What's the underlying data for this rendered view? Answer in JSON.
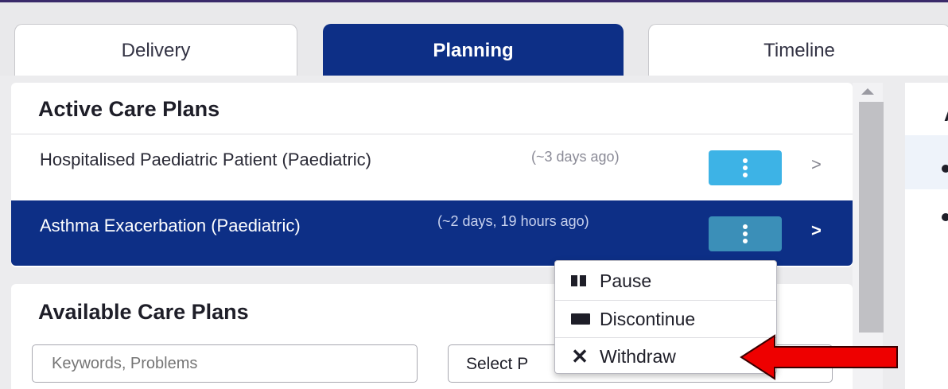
{
  "tabs": [
    {
      "label": "Delivery",
      "active": false
    },
    {
      "label": "Planning",
      "active": true
    },
    {
      "label": "Timeline",
      "active": false
    }
  ],
  "active_care_plans": {
    "title": "Active Care Plans",
    "items": [
      {
        "name": "Hospitalised Paediatric Patient (Paediatric)",
        "time": "(~3 days ago)",
        "selected": false
      },
      {
        "name": "Asthma Exacerbation (Paediatric)",
        "time": "(~2 days, 19 hours ago)",
        "selected": true
      }
    ],
    "chevron": ">"
  },
  "available_care_plans": {
    "title": "Available Care Plans",
    "search_placeholder": "Keywords, Problems",
    "select_value": "Select P"
  },
  "context_menu": {
    "items": [
      {
        "label": "Pause",
        "icon": "pause-icon"
      },
      {
        "label": "Discontinue",
        "icon": "stop-icon"
      },
      {
        "label": "Withdraw",
        "icon": "close-icon"
      }
    ]
  },
  "right_panel": {
    "title": "A"
  },
  "colors": {
    "primary_navy": "#0d2f86",
    "kebab_light": "#3db3e6",
    "kebab_selected": "#3b8fb8",
    "arrow_red": "#ee0000",
    "top_rule": "#3a2a6a"
  }
}
